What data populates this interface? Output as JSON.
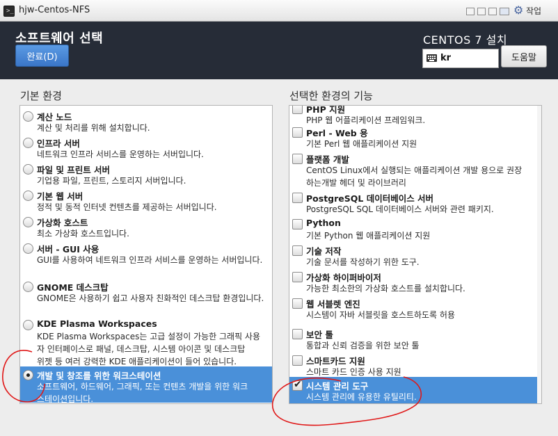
{
  "window": {
    "title": "hjw-Centos-NFS",
    "menu_label": "작업"
  },
  "header": {
    "title": "소프트웨어 선택",
    "done_label": "완료(D)",
    "product": "CENTOS 7 설치",
    "keyboard_layout": "kr",
    "help_label": "도움말"
  },
  "env_label": "기본 환경",
  "addon_label": "선택한 환경의 기능",
  "environments": [
    {
      "name": "계산 노드",
      "desc": "계산 및 처리를 위해 설치합니다.",
      "selected": false
    },
    {
      "name": "인프라 서버",
      "desc": "네트워크 인프라 서비스를 운영하는 서버입니다.",
      "selected": false
    },
    {
      "name": "파일 및 프린트 서버",
      "desc": "기업용 파일, 프린트, 스토리지 서버입니다.",
      "selected": false
    },
    {
      "name": "기본 웹 서버",
      "desc": "정적 및 동적 인터넷 컨텐츠를 제공하는 서버입니다.",
      "selected": false
    },
    {
      "name": "가상화 호스트",
      "desc": "최소 가상화 호스트입니다.",
      "selected": false
    },
    {
      "name": "서버 - GUI 사용",
      "desc": "GUI를 사용하여 네트워크 인프라 서비스를 운영하는 서버입니다.",
      "selected": false
    },
    {
      "name": "GNOME 데스크탑",
      "desc": "GNOME은 사용하기 쉽고 사용자 친화적인 데스크탑 환경입니다.",
      "selected": false
    },
    {
      "name": "KDE Plasma Workspaces",
      "desc": "KDE Plasma Workspaces는 고급 설정이 가능한 그래픽 사용\n자 인터페이스로 패널, 데스크탑, 시스템 아이콘 및 데스크탑\n위젯 등 여러 강력한 KDE 애플리케이션이 들어 있습니다.",
      "selected": false
    },
    {
      "name": "개발 및 창조를 위한 워크스테이션",
      "desc": "소프트웨어, 하드웨어, 그래픽, 또는 컨텐츠 개발을 위한 워크\n스테이션입니다.",
      "selected": true
    }
  ],
  "addons": [
    {
      "name": "PHP 지원",
      "desc": "PHP 웹 어플리케이션 프레임워크.",
      "checked": false,
      "selected": false
    },
    {
      "name": "Perl - Web 용",
      "desc": "기본 Perl 웹 애플리케이션 지원",
      "checked": false,
      "selected": false
    },
    {
      "name": "플랫폼 개발",
      "desc": "CentOS Linux에서 실행되는 애플리케이션 개발 용으로 권장\n하는개발 헤더 및 라이브러리",
      "checked": false,
      "selected": false
    },
    {
      "name": "PostgreSQL 데이터베이스 서버",
      "desc": "PostgreSQL SQL 데이터베이스 서버와 관련 패키지.",
      "checked": false,
      "selected": false
    },
    {
      "name": "Python",
      "desc": "기본 Python 웹 애플리케이션 지원",
      "checked": false,
      "selected": false
    },
    {
      "name": "기술 저작",
      "desc": "기술 문서를 작성하기 위한 도구.",
      "checked": false,
      "selected": false
    },
    {
      "name": "가상화 하이퍼바이저",
      "desc": "가능한 최소한의 가상화 호스트를 설치합니다.",
      "checked": false,
      "selected": false
    },
    {
      "name": "웹 서블렛 엔진",
      "desc": "시스템이 자바 서블릿을 호스트하도록 허용",
      "checked": false,
      "selected": false
    },
    {
      "name": "보안 툴",
      "desc": "통합과 신뢰 검증을 위한 보안 툴",
      "checked": false,
      "selected": false
    },
    {
      "name": "스마트카드 지원",
      "desc": "스마트 카드 인증 사용 지원",
      "checked": false,
      "selected": false
    },
    {
      "name": "시스템 관리 도구",
      "desc": "시스템 관리에 유용한 유틸리티.",
      "checked": true,
      "selected": true
    }
  ],
  "colors": {
    "header_bg": "#262c37",
    "selection": "#4a90d9",
    "annotation": "#e01818"
  }
}
